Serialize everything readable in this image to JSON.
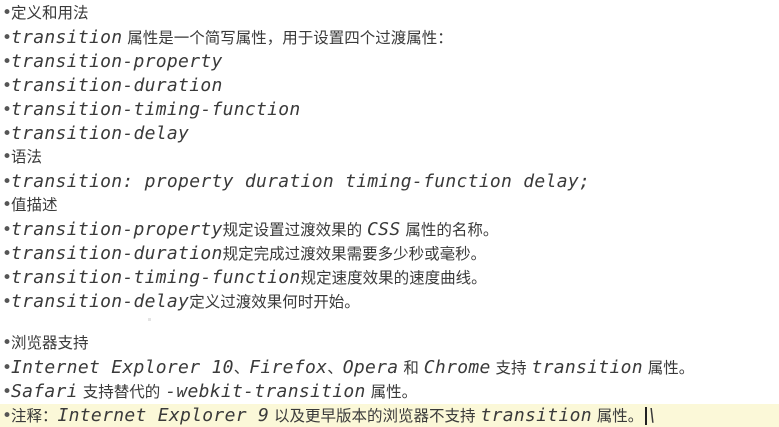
{
  "bullet": "•",
  "lines": {
    "l1": "定义和用法",
    "l2_code": "transition",
    "l2_text": " 属性是一个简写属性，用于设置四个过渡属性：",
    "l3": "transition-property",
    "l4": "transition-duration",
    "l5": "transition-timing-function",
    "l6": "transition-delay",
    "l7": "语法",
    "l8": "transition: property duration timing-function delay;",
    "l9": "值描述",
    "l10_code": "transition-property",
    "l10_text": "规定设置过渡效果的 ",
    "l10_code2": "CSS",
    "l10_text2": " 属性的名称。",
    "l11_code": "transition-duration",
    "l11_text": "规定完成过渡效果需要多少秒或毫秒。",
    "l12_code": "transition-timing-function",
    "l12_text": "规定速度效果的速度曲线。",
    "l13_code": "transition-delay",
    "l13_text": "定义过渡效果何时开始。",
    "l14": "浏览器支持",
    "l15_code1": "Internet Explorer 10",
    "l15_sep1": "、",
    "l15_code2": "Firefox",
    "l15_sep2": "、",
    "l15_code3": "Opera",
    "l15_text1": " 和 ",
    "l15_code4": "Chrome",
    "l15_text2": " 支持 ",
    "l15_code5": "transition",
    "l15_text3": " 属性。",
    "l16_code1": "Safari",
    "l16_text1": " 支持替代的 ",
    "l16_code2": "-webkit-transition",
    "l16_text2": " 属性。",
    "l17_text1": "注释：",
    "l17_code1": "Internet Explorer 9",
    "l17_text2": " 以及更早版本的浏览器不支持 ",
    "l17_code2": "transition",
    "l17_text3": " 属性。",
    "l17_tail": "\\"
  },
  "colors": {
    "text": "#3a3a3a",
    "highlight": "#fbf8d8",
    "background": "#ffffff"
  }
}
